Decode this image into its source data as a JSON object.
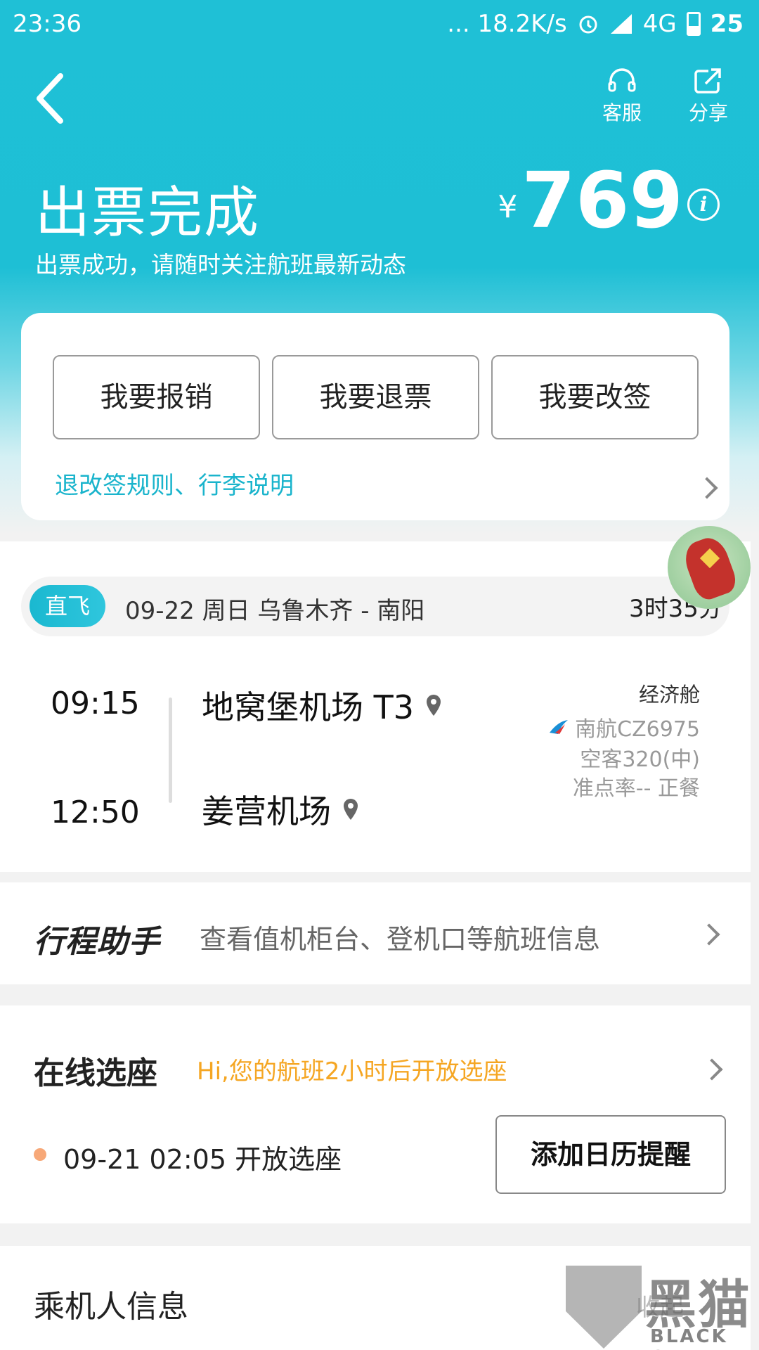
{
  "status_bar": {
    "time": "23:36",
    "net_speed": "... 18.2K/s",
    "network": "4G",
    "battery": "25"
  },
  "nav": {
    "service_label": "客服",
    "share_label": "分享"
  },
  "header": {
    "title": "出票完成",
    "subtitle": "出票成功，请随时关注航班最新动态",
    "currency": "¥",
    "price": "769"
  },
  "actions": {
    "reimburse": "我要报销",
    "refund": "我要退票",
    "change": "我要改签",
    "rules_link": "退改签规则、行李说明"
  },
  "flight": {
    "badge": "直飞",
    "date_route": "09-22  周日  乌鲁木齐 - 南阳",
    "duration": "3时35分",
    "dep_time": "09:15",
    "arr_time": "12:50",
    "dep_airport": "地窝堡机场 T3",
    "arr_airport": "姜营机场",
    "cabin": "经济舱",
    "flight_no": "南航CZ6975",
    "aircraft": "空客320(中)",
    "ontime": "准点率-- 正餐"
  },
  "assistant": {
    "logo": "行程助手",
    "desc": "查看值机柜台、登机口等航班信息"
  },
  "seat": {
    "title": "在线选座",
    "hint": "Hi,您的航班2小时后开放选座",
    "open_time": "09-21 02:05 开放选座",
    "calendar_button": "添加日历提醒"
  },
  "passenger": {
    "title": "乘机人信息",
    "collapse": "收起"
  },
  "watermark": {
    "cn": "黑猫",
    "en": "BLACK CAT"
  },
  "colors": {
    "accent": "#1ebfd5",
    "link": "#1ab4cc",
    "hint": "#f5a623"
  }
}
